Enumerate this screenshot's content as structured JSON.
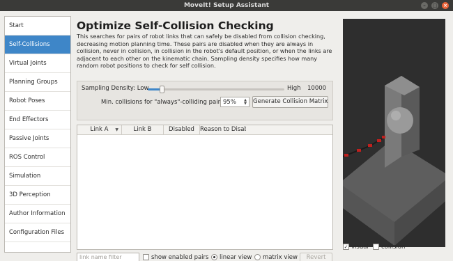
{
  "window": {
    "title": "MoveIt! Setup Assistant"
  },
  "sidebar": {
    "items": [
      {
        "label": "Start",
        "active": false
      },
      {
        "label": "Self-Collisions",
        "active": true
      },
      {
        "label": "Virtual Joints",
        "active": false
      },
      {
        "label": "Planning Groups",
        "active": false
      },
      {
        "label": "Robot Poses",
        "active": false
      },
      {
        "label": "End Effectors",
        "active": false
      },
      {
        "label": "Passive Joints",
        "active": false
      },
      {
        "label": "ROS Control",
        "active": false
      },
      {
        "label": "Simulation",
        "active": false
      },
      {
        "label": "3D Perception",
        "active": false
      },
      {
        "label": "Author Information",
        "active": false
      },
      {
        "label": "Configuration Files",
        "active": false
      }
    ]
  },
  "main": {
    "title": "Optimize Self-Collision Checking",
    "description": "This searches for pairs of robot links that can safely be disabled from collision checking, decreasing motion planning time. These pairs are disabled when they are always in collision, never in collision, in collision in the robot's default position, or when the links are adjacent to each other on the kinematic chain. Sampling density specifies how many random robot positions to check for self collision.",
    "sampling": {
      "label": "Sampling Density: Low",
      "high_label": "High",
      "value": "10000",
      "position_fraction": 0.1
    },
    "min_collisions": {
      "label": "Min. collisions for \"always\"-colliding pairs:",
      "value": "95%"
    },
    "generate_button": "Generate Collision Matrix",
    "table": {
      "columns": [
        "Link A",
        "Link B",
        "Disabled",
        "Reason to Disab"
      ]
    }
  },
  "bottom": {
    "filter_placeholder": "link name filter",
    "show_enabled_label": "show enabled pairs",
    "linear_view_label": "linear view",
    "matrix_view_label": "matrix view",
    "revert_label": "Revert"
  },
  "viewer": {
    "visual_label": "visual",
    "collision_label": "collision"
  },
  "colors": {
    "accent": "#3e86c8",
    "close_button": "#e9643a"
  }
}
